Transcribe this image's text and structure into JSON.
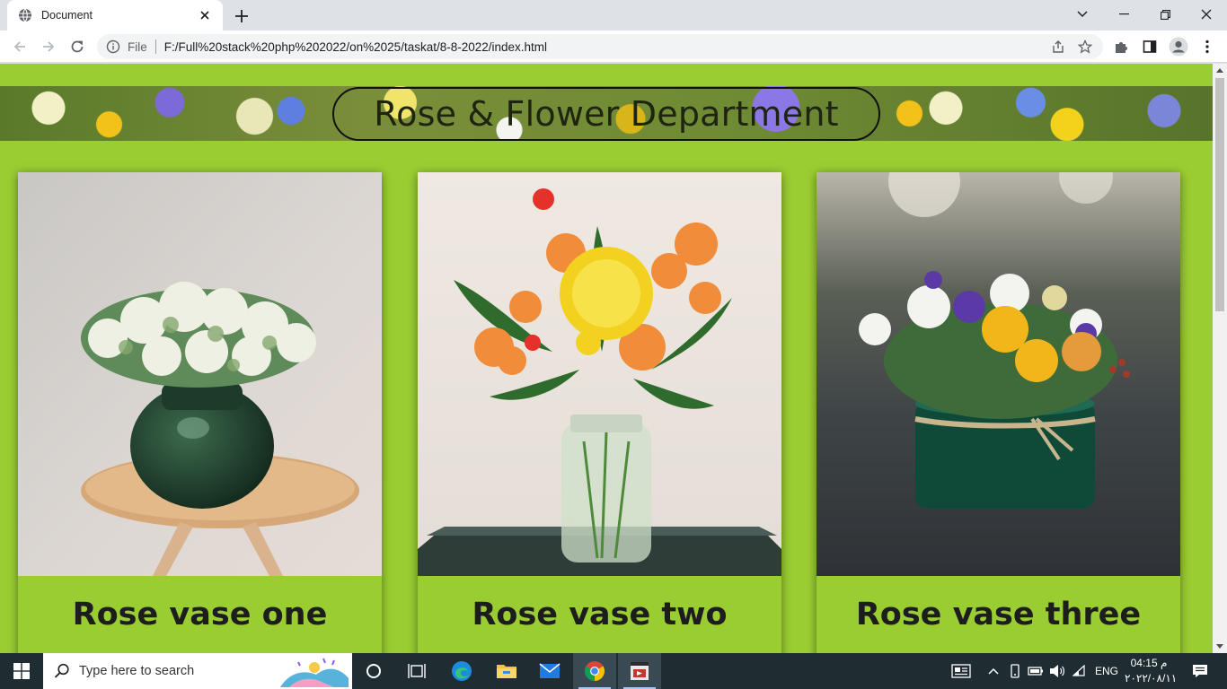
{
  "browser": {
    "tab_title": "Document",
    "file_label": "File",
    "url": "F:/Full%20stack%20php%202022/on%2025/taskat/8-8-2022/index.html"
  },
  "page": {
    "banner_title": "Rose & Flower Department",
    "cards": [
      {
        "caption": "Rose vase one",
        "image": "green-flower-vase-on-wooden-stool"
      },
      {
        "caption": "Rose vase two",
        "image": "orange-yellow-bouquet-in-glass-jar"
      },
      {
        "caption": "Rose vase three",
        "image": "flower-arrangement-in-green-velvet-pot"
      }
    ]
  },
  "taskbar": {
    "search_placeholder": "Type here to search",
    "language": "ENG",
    "time": "04:15 م",
    "date": "٢٠٢٢/٠٨/١١"
  },
  "colors": {
    "page_background": "#9acd32",
    "caption_text": "#1d1d1d",
    "taskbar": "#1f2d33"
  }
}
